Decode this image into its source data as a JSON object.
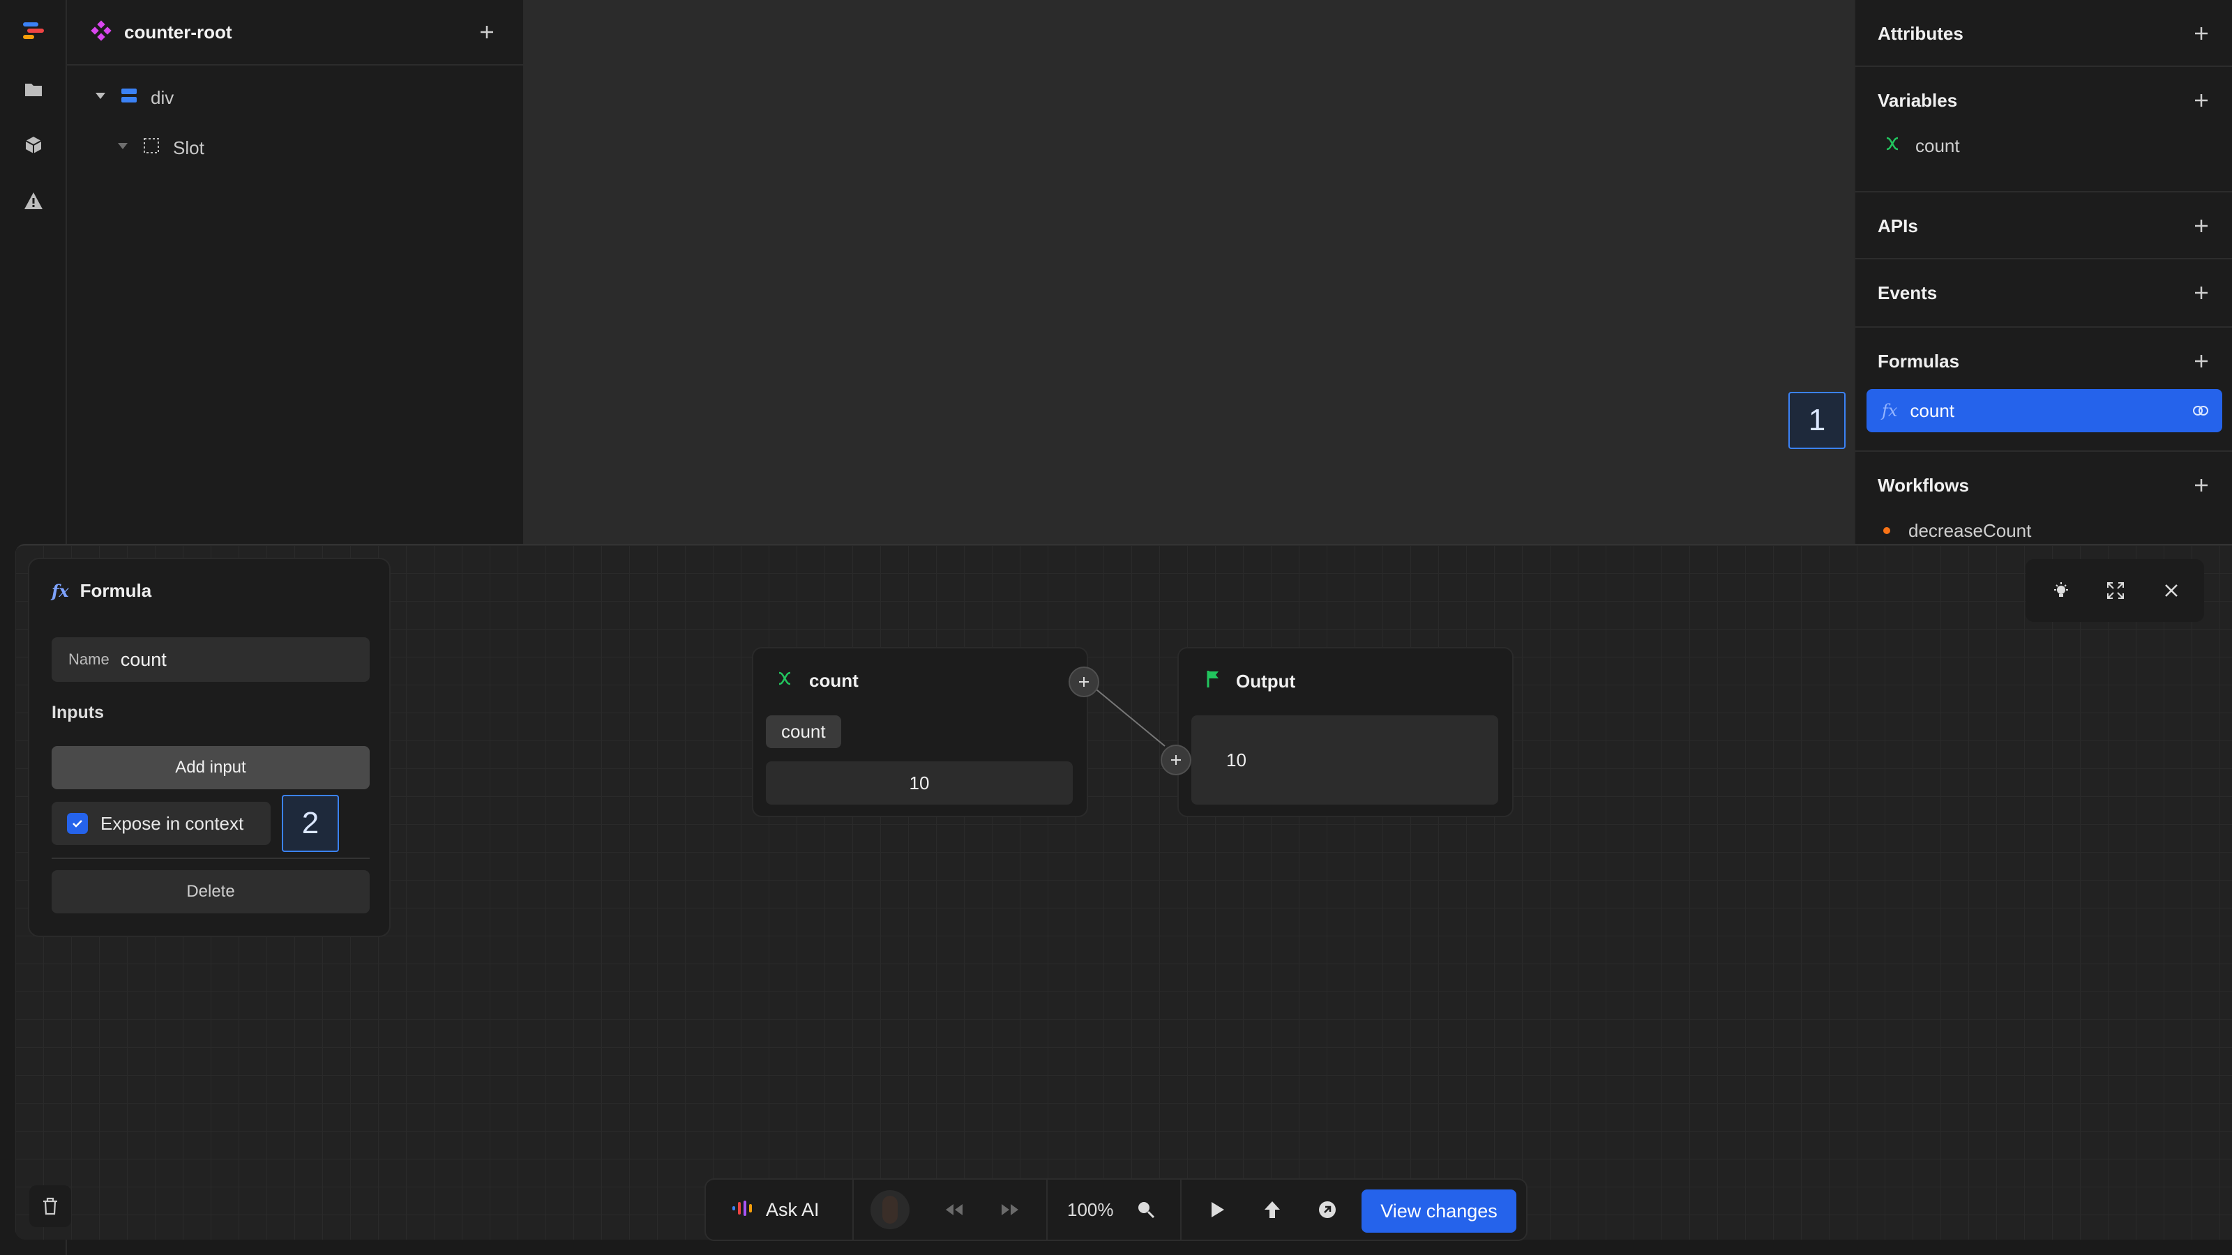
{
  "tree": {
    "component_name": "counter-root",
    "nodes": [
      {
        "label": "div"
      },
      {
        "label": "Slot"
      }
    ]
  },
  "right_panel": {
    "sections": {
      "attributes": "Attributes",
      "variables": "Variables",
      "variables_items": [
        "count"
      ],
      "apis": "APIs",
      "events": "Events",
      "formulas": "Formulas",
      "formulas_items": [
        "count"
      ],
      "workflows": "Workflows",
      "workflows_items": [
        "decreaseCount"
      ]
    }
  },
  "markers": {
    "one": "1",
    "two": "2"
  },
  "formula_panel": {
    "title": "Formula",
    "name_label": "Name",
    "name_value": "count",
    "inputs_label": "Inputs",
    "add_input_label": "Add input",
    "expose_label": "Expose in context",
    "expose_checked": true,
    "delete_label": "Delete"
  },
  "nodes": {
    "variable_node": {
      "title": "count",
      "pill": "count",
      "value": "10"
    },
    "output_node": {
      "title": "Output",
      "value": "10"
    }
  },
  "toolbar": {
    "ask_ai": "Ask AI",
    "zoom": "100%",
    "view_changes": "View changes"
  },
  "colors": {
    "accent": "#2563eb",
    "variable_green": "#22c55e",
    "component_pink": "#d946ef"
  }
}
